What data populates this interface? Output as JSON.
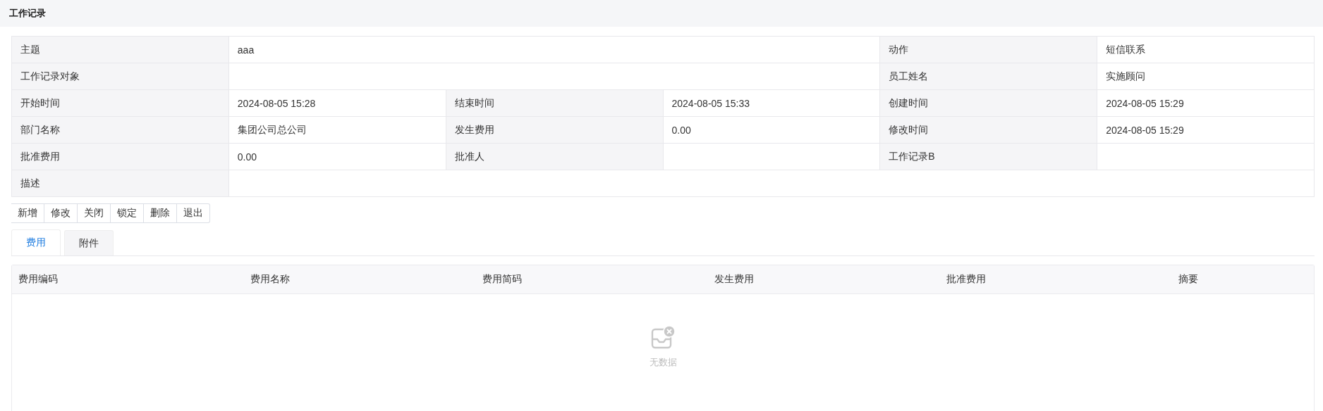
{
  "header": {
    "title": "工作记录"
  },
  "details": {
    "rows": [
      {
        "fields": [
          {
            "label": "主题",
            "value": "aaa"
          },
          {
            "label": "动作",
            "value": "短信联系"
          }
        ]
      },
      {
        "fields": [
          {
            "label": "工作记录对象"
          },
          {
            "label": "员工姓名",
            "value": "实施顾问"
          }
        ]
      },
      {
        "fields": [
          {
            "label": "开始时间",
            "value": "2024-08-05 15:28"
          },
          {
            "label": "结束时间",
            "value": "2024-08-05 15:33"
          },
          {
            "label": "创建时间",
            "value": "2024-08-05 15:29"
          }
        ]
      },
      {
        "fields": [
          {
            "label": "部门名称",
            "value": "集团公司总公司"
          },
          {
            "label": "发生费用",
            "value": "0.00"
          },
          {
            "label": "修改时间",
            "value": "2024-08-05 15:29"
          }
        ]
      },
      {
        "fields": [
          {
            "label": "批准费用",
            "value": "0.00"
          },
          {
            "label": "批准人"
          },
          {
            "label": "工作记录B"
          }
        ]
      },
      {
        "fields": [
          {
            "label": "描述"
          }
        ]
      }
    ]
  },
  "toolbar": {
    "buttons": [
      "新增",
      "修改",
      "关闭",
      "锁定",
      "删除",
      "退出"
    ]
  },
  "tabs": [
    {
      "label": "费用",
      "selected": true
    },
    {
      "label": "附件",
      "selected": false
    }
  ],
  "table": {
    "columns": [
      "费用编码",
      "费用名称",
      "费用简码",
      "发生费用",
      "批准费用",
      "摘要"
    ],
    "empty_text": "无数据"
  }
}
